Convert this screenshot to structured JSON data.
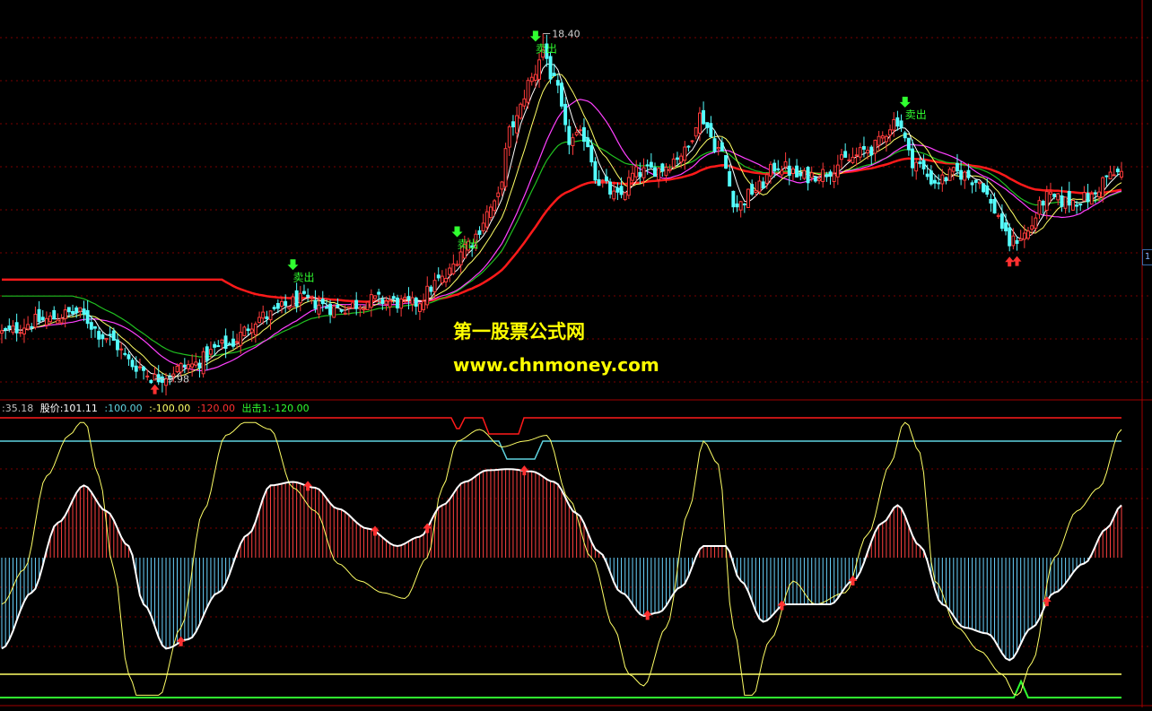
{
  "watermark": {
    "line1": "第一股票公式网",
    "line2": "www.chnmoney.com"
  },
  "indicator_legend": [
    {
      "text": ":35.18",
      "color": "#c0c0c0"
    },
    {
      "text": "股价:101.11",
      "color": "#ffffff"
    },
    {
      "text": ":100.00",
      "color": "#5fd3e0"
    },
    {
      "text": ":-100.00",
      "color": "#ffff66"
    },
    {
      "text": ":120.00",
      "color": "#ff3030"
    },
    {
      "text": "出击1:-120.00",
      "color": "#30ff30"
    }
  ],
  "right_tag": "1",
  "chart_data": [
    {
      "type": "candlestick",
      "panel": "price",
      "annotations": {
        "high_label": "18.40",
        "low_label": "9.98",
        "sell_label": "卖出"
      },
      "sell_signal_bars": [
        78,
        122,
        143,
        242
      ],
      "buy_signal_bars": [
        41,
        270,
        272
      ],
      "colors": {
        "up": "#ff3b3b",
        "down": "#54ffff",
        "ma_short": "#ffffff",
        "ma_mid": "#ffff66",
        "ma_long1": "#ff40ff",
        "ma_long2": "#20c020",
        "ma_long3": "#ff1a1a"
      },
      "price_anchors": [
        [
          0,
          11.1
        ],
        [
          10,
          11.4
        ],
        [
          20,
          11.6
        ],
        [
          28,
          11.0
        ],
        [
          36,
          10.3
        ],
        [
          41,
          10.0
        ],
        [
          50,
          10.3
        ],
        [
          60,
          10.8
        ],
        [
          70,
          11.5
        ],
        [
          80,
          11.9
        ],
        [
          90,
          11.7
        ],
        [
          100,
          11.9
        ],
        [
          110,
          11.8
        ],
        [
          118,
          12.4
        ],
        [
          125,
          13.3
        ],
        [
          132,
          14.2
        ],
        [
          137,
          16.2
        ],
        [
          142,
          17.3
        ],
        [
          145,
          18.0
        ],
        [
          148,
          17.2
        ],
        [
          152,
          15.8
        ],
        [
          156,
          15.9
        ],
        [
          160,
          14.8
        ],
        [
          165,
          14.4
        ],
        [
          170,
          15.0
        ],
        [
          176,
          15.1
        ],
        [
          183,
          15.5
        ],
        [
          187,
          16.4
        ],
        [
          192,
          15.6
        ],
        [
          197,
          14.2
        ],
        [
          202,
          14.6
        ],
        [
          208,
          15.2
        ],
        [
          214,
          14.9
        ],
        [
          220,
          15.0
        ],
        [
          226,
          15.3
        ],
        [
          233,
          15.6
        ],
        [
          240,
          16.3
        ],
        [
          244,
          15.3
        ],
        [
          250,
          14.8
        ],
        [
          256,
          15.0
        ],
        [
          262,
          14.8
        ],
        [
          266,
          14.1
        ],
        [
          270,
          13.3
        ],
        [
          274,
          13.5
        ],
        [
          280,
          14.4
        ],
        [
          285,
          14.3
        ],
        [
          292,
          14.4
        ],
        [
          296,
          14.9
        ],
        [
          300,
          15.0
        ]
      ]
    },
    {
      "type": "oscillator",
      "panel": "indicator",
      "levels": {
        "upper": 100.0,
        "lower": -100.0,
        "red_line": 120.0,
        "strike": -120.0
      },
      "current": {
        "value": 35.18,
        "price_line": 101.11
      },
      "colors": {
        "histogram_up": "#ff4040",
        "histogram_down": "#6ad4ff",
        "main_line": "#ffffff",
        "fast_line": "#ffff66",
        "upper": "#5fd3e0",
        "lower": "#ffff66",
        "red_line": "#ff1a1a",
        "strike": "#30ff30"
      },
      "main_anchors": [
        [
          0,
          -78
        ],
        [
          8,
          -30
        ],
        [
          15,
          30
        ],
        [
          22,
          62
        ],
        [
          28,
          40
        ],
        [
          34,
          10
        ],
        [
          38,
          -40
        ],
        [
          44,
          -78
        ],
        [
          50,
          -70
        ],
        [
          58,
          -30
        ],
        [
          66,
          20
        ],
        [
          72,
          62
        ],
        [
          78,
          65
        ],
        [
          84,
          60
        ],
        [
          90,
          42
        ],
        [
          98,
          25
        ],
        [
          106,
          10
        ],
        [
          112,
          18
        ],
        [
          118,
          45
        ],
        [
          124,
          65
        ],
        [
          130,
          75
        ],
        [
          136,
          76
        ],
        [
          142,
          74
        ],
        [
          148,
          65
        ],
        [
          154,
          38
        ],
        [
          160,
          5
        ],
        [
          166,
          -30
        ],
        [
          172,
          -50
        ],
        [
          176,
          -47
        ],
        [
          182,
          -25
        ],
        [
          188,
          10
        ],
        [
          194,
          10
        ],
        [
          198,
          -20
        ],
        [
          204,
          -55
        ],
        [
          210,
          -40
        ],
        [
          216,
          -40
        ],
        [
          222,
          -40
        ],
        [
          228,
          -20
        ],
        [
          236,
          30
        ],
        [
          240,
          45
        ],
        [
          246,
          10
        ],
        [
          252,
          -40
        ],
        [
          258,
          -60
        ],
        [
          264,
          -65
        ],
        [
          270,
          -88
        ],
        [
          276,
          -60
        ],
        [
          282,
          -30
        ],
        [
          290,
          -5
        ],
        [
          296,
          25
        ],
        [
          300,
          45
        ]
      ],
      "fast_anchors": [
        [
          0,
          -40
        ],
        [
          6,
          -10
        ],
        [
          12,
          70
        ],
        [
          18,
          105
        ],
        [
          22,
          120
        ],
        [
          26,
          70
        ],
        [
          30,
          -10
        ],
        [
          34,
          -100
        ],
        [
          38,
          -145
        ],
        [
          42,
          -120
        ],
        [
          48,
          -60
        ],
        [
          54,
          40
        ],
        [
          60,
          105
        ],
        [
          66,
          118
        ],
        [
          72,
          110
        ],
        [
          78,
          60
        ],
        [
          84,
          40
        ],
        [
          90,
          -5
        ],
        [
          96,
          -20
        ],
        [
          102,
          -30
        ],
        [
          108,
          -35
        ],
        [
          114,
          0
        ],
        [
          118,
          60
        ],
        [
          122,
          100
        ],
        [
          128,
          110
        ],
        [
          134,
          95
        ],
        [
          140,
          100
        ],
        [
          146,
          105
        ],
        [
          152,
          50
        ],
        [
          158,
          0
        ],
        [
          164,
          -60
        ],
        [
          168,
          -100
        ],
        [
          172,
          -110
        ],
        [
          178,
          -60
        ],
        [
          184,
          40
        ],
        [
          188,
          100
        ],
        [
          192,
          80
        ],
        [
          196,
          -60
        ],
        [
          200,
          -130
        ],
        [
          206,
          -70
        ],
        [
          212,
          -20
        ],
        [
          218,
          -40
        ],
        [
          226,
          -30
        ],
        [
          232,
          20
        ],
        [
          238,
          80
        ],
        [
          242,
          118
        ],
        [
          246,
          90
        ],
        [
          250,
          -20
        ],
        [
          256,
          -60
        ],
        [
          262,
          -80
        ],
        [
          268,
          -100
        ],
        [
          272,
          -120
        ],
        [
          276,
          -90
        ],
        [
          282,
          0
        ],
        [
          288,
          40
        ],
        [
          294,
          60
        ],
        [
          300,
          110
        ]
      ],
      "marker_bars": [
        48,
        82,
        100,
        114,
        140,
        173,
        209,
        228,
        280
      ]
    }
  ]
}
